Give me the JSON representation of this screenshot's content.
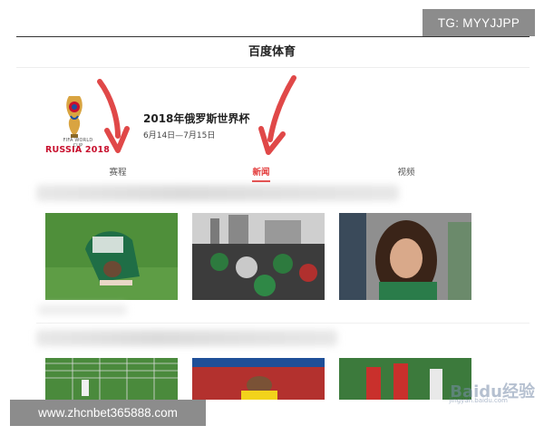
{
  "header": {
    "title": "百度体育"
  },
  "event": {
    "logo_lines": [
      "FIFA WORLD CUP",
      "RUSSIA 2018"
    ],
    "name": "2018年俄罗斯世界杯",
    "dates": "6月14日—7月15日"
  },
  "tabs": [
    {
      "label": "赛程",
      "active": false
    },
    {
      "label": "新闻",
      "active": true
    },
    {
      "label": "视频",
      "active": false
    }
  ],
  "watermarks": {
    "top_badge": "TG: MYYJJPP",
    "bottom_badge": "www.zhcnbet365888.com",
    "baidu_logo": "Baidu经验",
    "baidu_sub": "jingyan.baidu.com"
  },
  "colors": {
    "accent": "#e33a3a",
    "arrow": "#e04848",
    "badge_bg": "#8c8c8c"
  }
}
